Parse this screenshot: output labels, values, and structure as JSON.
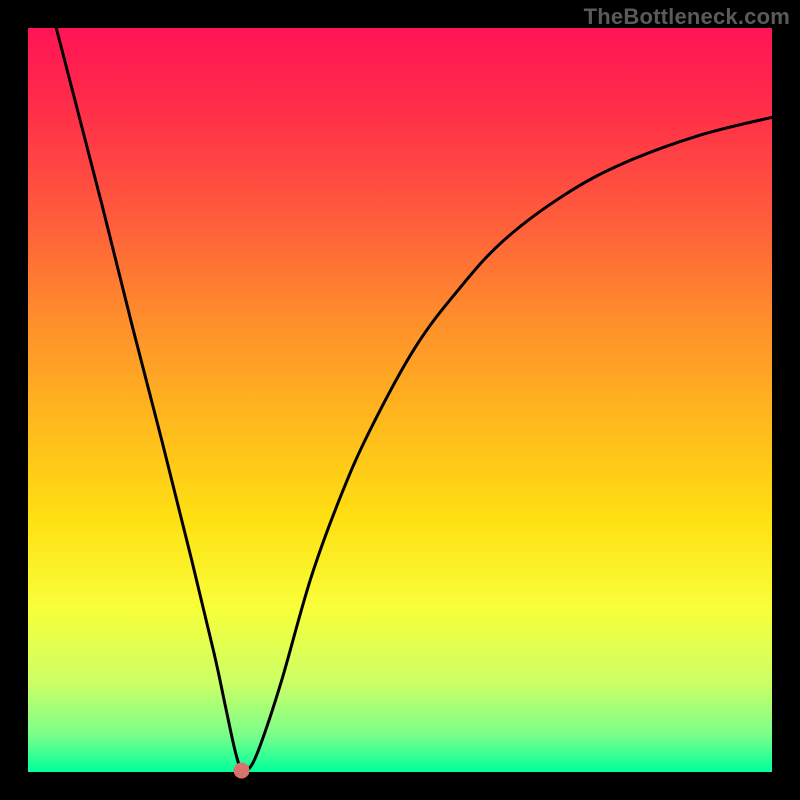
{
  "watermark": "TheBottleneck.com",
  "chart_data": {
    "type": "line",
    "title": "",
    "xlabel": "",
    "ylabel": "",
    "xlim": [
      0,
      100
    ],
    "ylim": [
      0,
      100
    ],
    "grid": false,
    "legend": false,
    "series": [
      {
        "name": "bottleneck-curve",
        "x": [
          3.8,
          6,
          10,
          14,
          18,
          22,
          25,
          26.5,
          27.8,
          28.7,
          29.5,
          31,
          34,
          38,
          42,
          46,
          52,
          58,
          64,
          72,
          80,
          90,
          100
        ],
        "y": [
          100,
          91.5,
          76,
          60,
          44.5,
          28.5,
          16,
          9,
          3,
          0.2,
          0.2,
          3,
          12,
          26,
          37,
          46,
          57,
          65,
          71.5,
          77.5,
          81.8,
          85.5,
          88
        ]
      }
    ],
    "marker": {
      "x": 28.7,
      "y": 0.2,
      "color": "#d9716c",
      "radius": 8
    },
    "colors": {
      "background_top": "#ff1455",
      "background_bottom": "#00ff9a",
      "curve": "#000000",
      "frame": "#000000"
    }
  }
}
